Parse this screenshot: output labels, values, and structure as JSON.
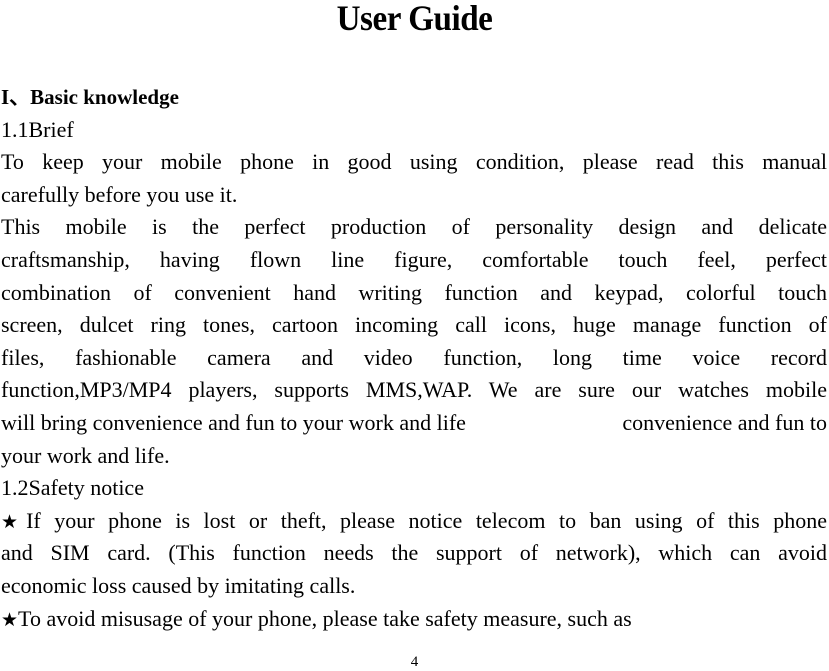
{
  "document": {
    "title": "User Guide",
    "section_heading": "I、Basic knowledge",
    "subsection_1": "1.1Brief",
    "brief_paragraph_1": [
      "To keep your mobile phone in good using condition, please read this manual",
      "carefully before you use it."
    ],
    "brief_paragraph_2": [
      "This mobile is the perfect production of personality design and delicate",
      "craftsmanship, having flown line figure, comfortable touch feel, perfect",
      "combination of convenient hand writing function and keypad, colorful touch",
      "screen, dulcet ring tones, cartoon incoming call icons, huge manage function of",
      "files, fashionable camera and video function, long time voice record",
      "function,MP3/MP4 players, supports MMS,WAP. We are sure our watches mobile"
    ],
    "brief_paragraph_2_line7_part1": "will bring convenience and fun to your work and life",
    "brief_paragraph_2_line7_part2": "convenience and fun to",
    "brief_paragraph_2_line8": "your work and life.",
    "subsection_2": "1.2Safety notice",
    "star_symbol": "★",
    "safety_item_1": [
      "If your phone is lost or theft, please notice telecom to ban using of this phone",
      "and SIM card. (This function needs the support of network), which can avoid",
      "economic loss caused by imitating calls."
    ],
    "safety_item_2": "To avoid misusage of your phone, please take safety measure, such as",
    "page_number": "4"
  }
}
